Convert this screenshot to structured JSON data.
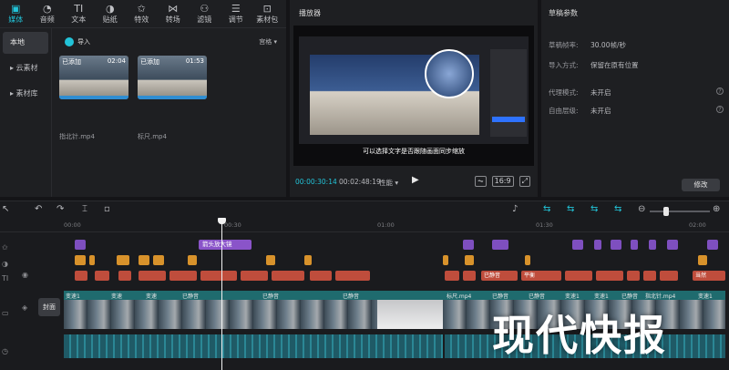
{
  "toolbar": {
    "items": [
      {
        "label": "媒体",
        "icon": "media-icon",
        "glyph": "▣",
        "active": true
      },
      {
        "label": "音频",
        "icon": "audio-icon",
        "glyph": "◔"
      },
      {
        "label": "文本",
        "icon": "text-icon",
        "glyph": "TI"
      },
      {
        "label": "贴纸",
        "icon": "sticker-icon",
        "glyph": "◑"
      },
      {
        "label": "特效",
        "icon": "effects-icon",
        "glyph": "✩"
      },
      {
        "label": "转场",
        "icon": "transition-icon",
        "glyph": "⋈"
      },
      {
        "label": "滤镜",
        "icon": "filter-icon",
        "glyph": "⚇"
      },
      {
        "label": "调节",
        "icon": "adjust-icon",
        "glyph": "☰"
      },
      {
        "label": "素材包",
        "icon": "package-icon",
        "glyph": "⊡"
      }
    ]
  },
  "leftnav": {
    "items": [
      {
        "label": "本地",
        "active": true
      },
      {
        "label": "▸ 云素材"
      },
      {
        "label": "▸ 素材库"
      }
    ]
  },
  "media": {
    "import_label": "导入",
    "view_label": "宫格 ▾",
    "clips": [
      {
        "tag": "已添加",
        "duration": "02:04",
        "name": "指北针.mp4"
      },
      {
        "tag": "已添加",
        "duration": "01:53",
        "name": "标尺.mp4"
      }
    ]
  },
  "player": {
    "title": "播放器",
    "subtitle": "可以选择文字是否跟随画面同步缩放",
    "current_time": "00:00:30:14",
    "total_time": "00:02:48:19",
    "perf_label": "性能 ▾",
    "ratio_label": "16:9"
  },
  "draft": {
    "title": "草稿参数",
    "rows": [
      {
        "label": "草稿帧率:",
        "value": "30.00帧/秒"
      },
      {
        "label": "导入方式:",
        "value": "保留在原有位置"
      },
      {
        "label": "代理模式:",
        "value": "未开启"
      },
      {
        "label": "自由层级:",
        "value": "未开启"
      }
    ],
    "edit_label": "修改"
  },
  "timeline": {
    "ruler": [
      "00:00",
      "00:30",
      "01:00",
      "01:30",
      "02:00"
    ],
    "cover_label": "封面",
    "purple_label": "箭头放大镜",
    "video_labels": [
      "变速1",
      "变速",
      "变速",
      "已静音",
      "已静音",
      "已静音",
      "标尺.mp4",
      "已静音",
      "已静音",
      "变速1",
      "变速1",
      "已静音",
      "指北针.mp4",
      "变速1"
    ],
    "text_labels": [
      "已静音",
      "平衡",
      "当然"
    ]
  },
  "watermark": "现代快报"
}
